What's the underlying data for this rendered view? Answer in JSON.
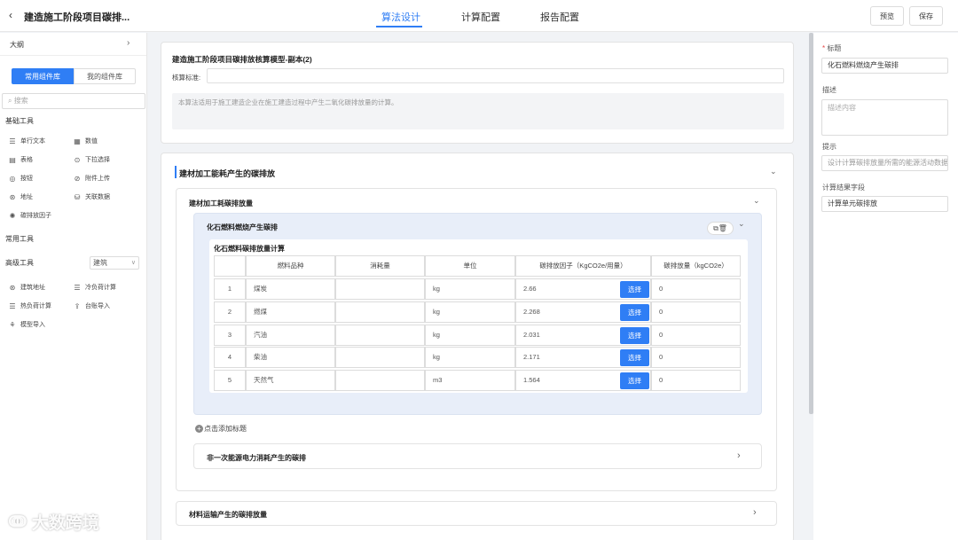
{
  "header": {
    "back": "‹",
    "title": "建造施工阶段项目碳排...",
    "tabs": [
      "算法设计",
      "计算配置",
      "报告配置"
    ],
    "preview": "预览",
    "save": "保存"
  },
  "sidebar": {
    "outline": "大纲",
    "chevron": "›",
    "tab_common": "常用组件库",
    "tab_mine": "我的组件库",
    "search_placeholder": "搜索",
    "basic_title": "基础工具",
    "basic_tools": [
      "单行文本",
      "数值",
      "表格",
      "下拉选择",
      "按钮",
      "附件上传",
      "地址",
      "关联数据",
      "碳排放因子"
    ],
    "common_title": "常用工具",
    "advanced_title": "高级工具",
    "advanced_select": "建筑",
    "advanced_tools": [
      "建筑地址",
      "冷负荷计算",
      "热负荷计算",
      "台账导入",
      "模型导入"
    ]
  },
  "main": {
    "model_title": "建造施工阶段项目碳排放核算模型-副本(2)",
    "standard_label": "核算标准:",
    "description": "本算法适用于施工建造企业在施工建造过程中产生二氧化碳排放量的计算。",
    "section_title": "建材加工能耗产生的碳排放",
    "sub_title": "建材加工耗碳排放量",
    "group_title": "化石燃料燃烧产生碳排",
    "table_title": "化石燃料碳排放量计算",
    "columns": [
      "燃料品种",
      "消耗量",
      "单位",
      "碳排放因子（KgCO2e/用量）",
      "碳排放量（kgCO2e）"
    ],
    "rows": [
      {
        "no": "1",
        "fuel": "煤炭",
        "consumption": "",
        "unit": "kg",
        "factor": "2.66",
        "emission": "0"
      },
      {
        "no": "2",
        "fuel": "燃煤",
        "consumption": "",
        "unit": "kg",
        "factor": "2.268",
        "emission": "0"
      },
      {
        "no": "3",
        "fuel": "汽油",
        "consumption": "",
        "unit": "kg",
        "factor": "2.031",
        "emission": "0"
      },
      {
        "no": "4",
        "fuel": "柴油",
        "consumption": "",
        "unit": "kg",
        "factor": "2.171",
        "emission": "0"
      },
      {
        "no": "5",
        "fuel": "天然气",
        "consumption": "",
        "unit": "m3",
        "factor": "1.564",
        "emission": "0"
      }
    ],
    "select_label": "选择",
    "add_title": "点击添加标题",
    "collapsed_1": "非一次能源电力消耗产生的碳排",
    "collapsed_2": "材料运输产生的碳排放量"
  },
  "properties": {
    "title_label": "标题",
    "title_value": "化石燃料燃烧产生碳排",
    "desc_label": "描述",
    "desc_placeholder": "描述内容",
    "hint_label": "提示",
    "hint_value": "设计计算碳排放量所需的能源活动数据",
    "result_label": "计算结果字段",
    "result_value": "计算单元碳排放"
  },
  "watermark": "大数跨境",
  "colors": {
    "accent": "#2f7ef5"
  }
}
